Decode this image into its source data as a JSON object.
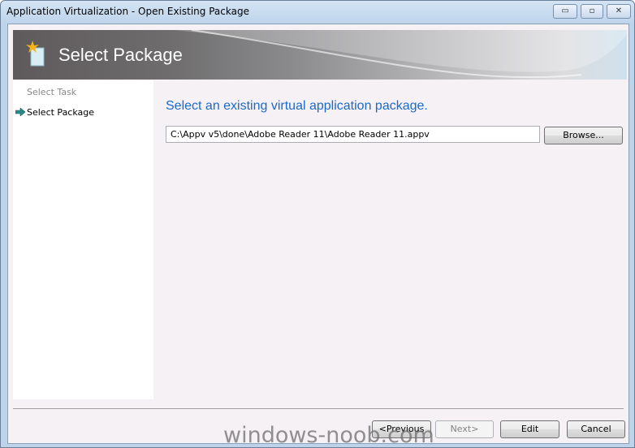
{
  "window": {
    "title": "Application Virtualization - Open Existing Package",
    "minimize": "▭",
    "maximize": "▫",
    "close": "✕"
  },
  "banner": {
    "title": "Select Package",
    "icon": "package-icon"
  },
  "sidebar": {
    "steps": [
      {
        "label": "Select Task",
        "active": false
      },
      {
        "label": "Select Package",
        "active": true
      }
    ],
    "arrow_icon": "arrow-right-icon"
  },
  "main": {
    "heading": "Select an existing virtual application package.",
    "path_value": "C:\\Appv v5\\done\\Adobe Reader 11\\Adobe Reader 11.appv",
    "browse_label": "Browse..."
  },
  "footer": {
    "previous": "<Previous",
    "next": "Next>",
    "edit": "Edit",
    "cancel": "Cancel"
  },
  "watermark": "windows-noob.com",
  "colors": {
    "heading": "#1c6ac8",
    "arrow": "#2a8a8a"
  }
}
